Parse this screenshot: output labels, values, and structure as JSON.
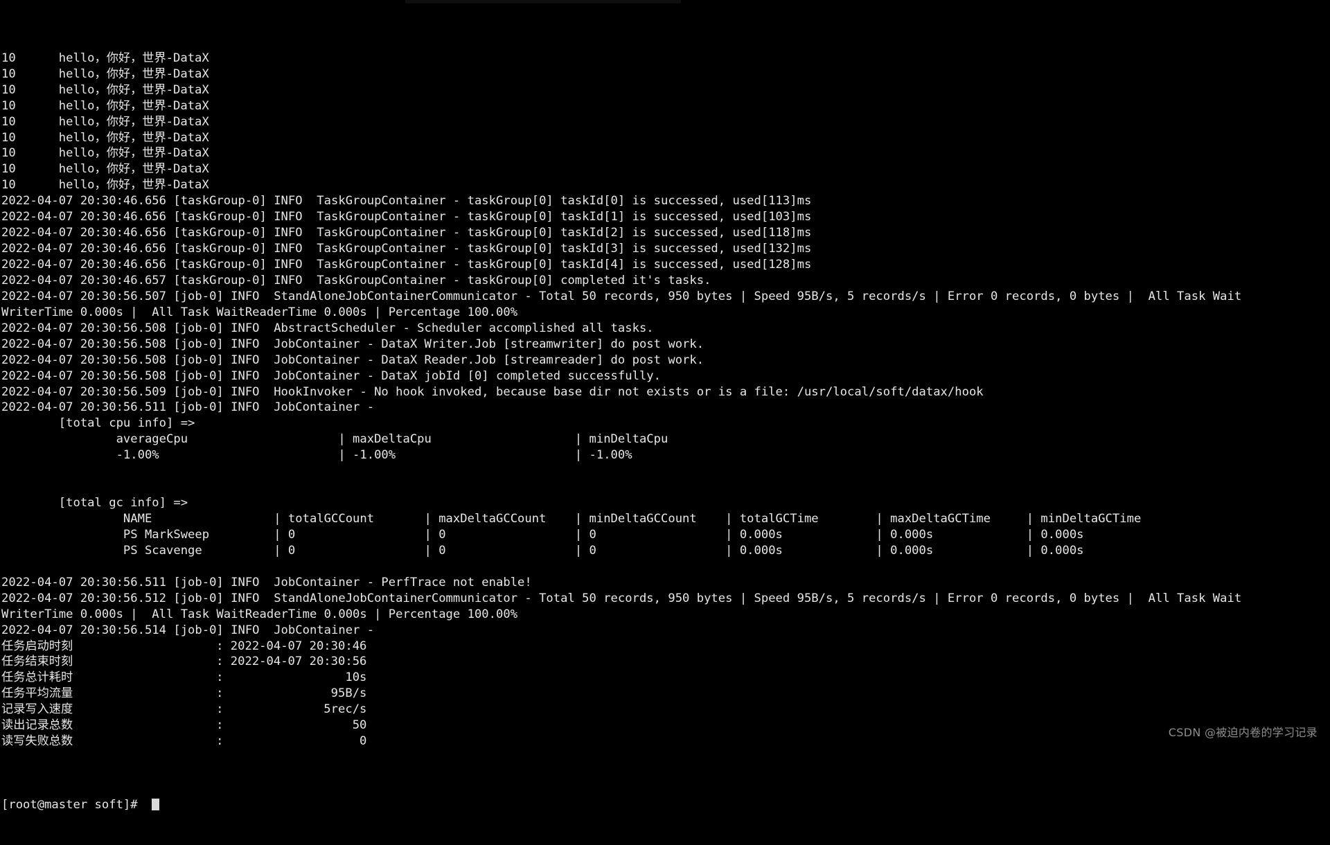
{
  "terminal": {
    "background_color": "#000000",
    "text_color": "#e6e6e6",
    "watermark": "CSDN @被迫内卷的学习记录",
    "prompt": "[root@master soft]# ",
    "lines": [
      "10      hello，你好，世界-DataX",
      "10      hello，你好，世界-DataX",
      "10      hello，你好，世界-DataX",
      "10      hello，你好，世界-DataX",
      "10      hello，你好，世界-DataX",
      "10      hello，你好，世界-DataX",
      "10      hello，你好，世界-DataX",
      "10      hello，你好，世界-DataX",
      "10      hello，你好，世界-DataX",
      "2022-04-07 20:30:46.656 [taskGroup-0] INFO  TaskGroupContainer - taskGroup[0] taskId[0] is successed, used[113]ms",
      "2022-04-07 20:30:46.656 [taskGroup-0] INFO  TaskGroupContainer - taskGroup[0] taskId[1] is successed, used[103]ms",
      "2022-04-07 20:30:46.656 [taskGroup-0] INFO  TaskGroupContainer - taskGroup[0] taskId[2] is successed, used[118]ms",
      "2022-04-07 20:30:46.656 [taskGroup-0] INFO  TaskGroupContainer - taskGroup[0] taskId[3] is successed, used[132]ms",
      "2022-04-07 20:30:46.656 [taskGroup-0] INFO  TaskGroupContainer - taskGroup[0] taskId[4] is successed, used[128]ms",
      "2022-04-07 20:30:46.657 [taskGroup-0] INFO  TaskGroupContainer - taskGroup[0] completed it's tasks.",
      "2022-04-07 20:30:56.507 [job-0] INFO  StandAloneJobContainerCommunicator - Total 50 records, 950 bytes | Speed 95B/s, 5 records/s | Error 0 records, 0 bytes |  All Task Wait",
      "WriterTime 0.000s |  All Task WaitReaderTime 0.000s | Percentage 100.00%",
      "2022-04-07 20:30:56.508 [job-0] INFO  AbstractScheduler - Scheduler accomplished all tasks.",
      "2022-04-07 20:30:56.508 [job-0] INFO  JobContainer - DataX Writer.Job [streamwriter] do post work.",
      "2022-04-07 20:30:56.508 [job-0] INFO  JobContainer - DataX Reader.Job [streamreader] do post work.",
      "2022-04-07 20:30:56.508 [job-0] INFO  JobContainer - DataX jobId [0] completed successfully.",
      "2022-04-07 20:30:56.509 [job-0] INFO  HookInvoker - No hook invoked, because base dir not exists or is a file: /usr/local/soft/datax/hook",
      "2022-04-07 20:30:56.511 [job-0] INFO  JobContainer - ",
      "        [total cpu info] => ",
      "                averageCpu                     | maxDeltaCpu                    | minDeltaCpu                    ",
      "                -1.00%                         | -1.00%                         | -1.00%                         ",
      "",
      "",
      "        [total gc info] => ",
      "                 NAME                 | totalGCCount       | maxDeltaGCCount    | minDeltaGCCount    | totalGCTime        | maxDeltaGCTime     | minDeltaGCTime     ",
      "                 PS MarkSweep         | 0                  | 0                  | 0                  | 0.000s             | 0.000s             | 0.000s             ",
      "                 PS Scavenge          | 0                  | 0                  | 0                  | 0.000s             | 0.000s             | 0.000s             ",
      "",
      "2022-04-07 20:30:56.511 [job-0] INFO  JobContainer - PerfTrace not enable!",
      "2022-04-07 20:30:56.512 [job-0] INFO  StandAloneJobContainerCommunicator - Total 50 records, 950 bytes | Speed 95B/s, 5 records/s | Error 0 records, 0 bytes |  All Task Wait",
      "WriterTime 0.000s |  All Task WaitReaderTime 0.000s | Percentage 100.00%",
      "2022-04-07 20:30:56.514 [job-0] INFO  JobContainer - ",
      "任务启动时刻                    : 2022-04-07 20:30:46",
      "任务结束时刻                    : 2022-04-07 20:30:56",
      "任务总计耗时                    :                 10s",
      "任务平均流量                    :               95B/s",
      "记录写入速度                    :              5rec/s",
      "读出记录总数                    :                  50",
      "读写失败总数                    :                   0",
      ""
    ]
  }
}
